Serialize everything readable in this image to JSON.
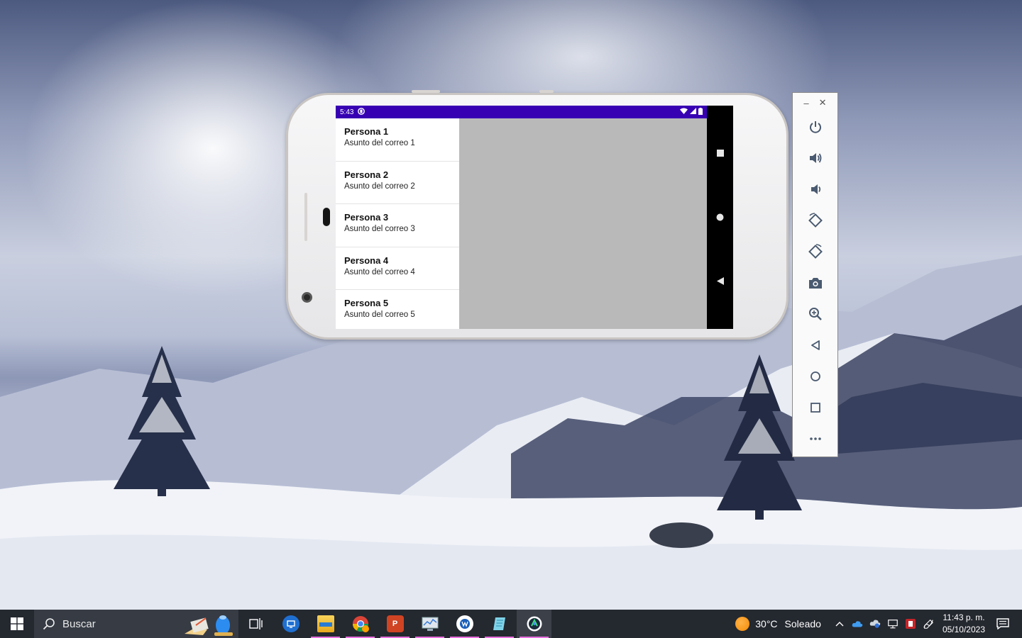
{
  "emulator": {
    "status_bar": {
      "time": "5:43"
    },
    "mail_list": [
      {
        "name": "Persona 1",
        "subject": "Asunto del correo 1"
      },
      {
        "name": "Persona 2",
        "subject": "Asunto del correo 2"
      },
      {
        "name": "Persona 3",
        "subject": "Asunto del correo 3"
      },
      {
        "name": "Persona 4",
        "subject": "Asunto del correo 4"
      },
      {
        "name": "Persona 5",
        "subject": "Asunto del correo 5"
      }
    ],
    "toolbar": {
      "window_buttons": {
        "minimize": "–",
        "close": "✕"
      },
      "buttons": [
        "power-icon",
        "volume-up-icon",
        "volume-down-icon",
        "rotate-left-icon",
        "rotate-right-icon",
        "camera-icon",
        "zoom-icon",
        "back-icon",
        "home-icon",
        "overview-icon",
        "more-icon"
      ]
    },
    "colors": {
      "status_bar": "#3700b3",
      "detail_pane": "#b9b9b9"
    }
  },
  "taskbar": {
    "search_placeholder": "Buscar",
    "apps": [
      "task-view-icon",
      "remote-desktop-icon",
      "file-explorer-icon",
      "chrome-icon",
      "powerpoint-icon",
      "system-monitor-icon",
      "word-app-icon",
      "notepad-icon",
      "android-studio-icon"
    ],
    "weather": {
      "temperature": "30°C",
      "condition": "Soleado"
    },
    "clock": {
      "time": "11:43 p. m.",
      "date": "05/10/2023"
    }
  }
}
